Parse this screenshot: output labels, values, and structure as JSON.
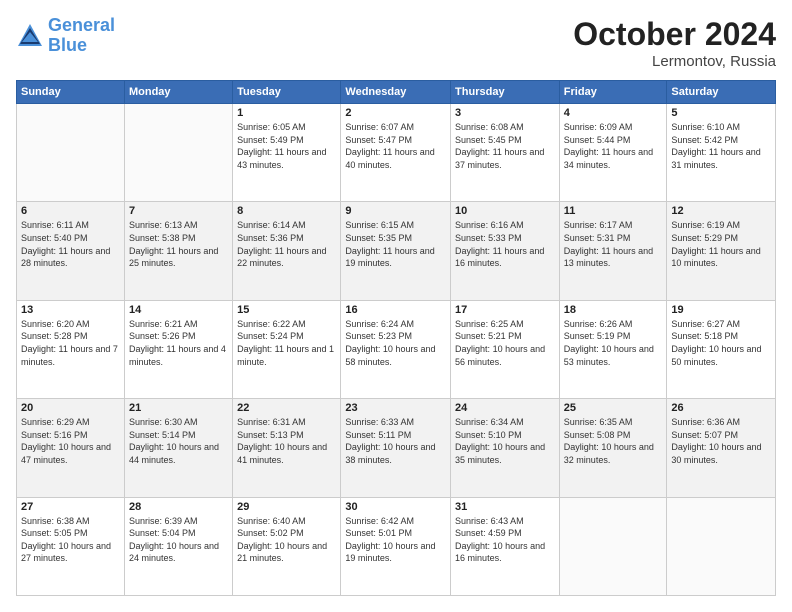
{
  "header": {
    "logo_line1": "General",
    "logo_line2": "Blue",
    "month": "October 2024",
    "location": "Lermontov, Russia"
  },
  "weekdays": [
    "Sunday",
    "Monday",
    "Tuesday",
    "Wednesday",
    "Thursday",
    "Friday",
    "Saturday"
  ],
  "weeks": [
    [
      {
        "day": "",
        "info": ""
      },
      {
        "day": "",
        "info": ""
      },
      {
        "day": "1",
        "info": "Sunrise: 6:05 AM\nSunset: 5:49 PM\nDaylight: 11 hours and 43 minutes."
      },
      {
        "day": "2",
        "info": "Sunrise: 6:07 AM\nSunset: 5:47 PM\nDaylight: 11 hours and 40 minutes."
      },
      {
        "day": "3",
        "info": "Sunrise: 6:08 AM\nSunset: 5:45 PM\nDaylight: 11 hours and 37 minutes."
      },
      {
        "day": "4",
        "info": "Sunrise: 6:09 AM\nSunset: 5:44 PM\nDaylight: 11 hours and 34 minutes."
      },
      {
        "day": "5",
        "info": "Sunrise: 6:10 AM\nSunset: 5:42 PM\nDaylight: 11 hours and 31 minutes."
      }
    ],
    [
      {
        "day": "6",
        "info": "Sunrise: 6:11 AM\nSunset: 5:40 PM\nDaylight: 11 hours and 28 minutes."
      },
      {
        "day": "7",
        "info": "Sunrise: 6:13 AM\nSunset: 5:38 PM\nDaylight: 11 hours and 25 minutes."
      },
      {
        "day": "8",
        "info": "Sunrise: 6:14 AM\nSunset: 5:36 PM\nDaylight: 11 hours and 22 minutes."
      },
      {
        "day": "9",
        "info": "Sunrise: 6:15 AM\nSunset: 5:35 PM\nDaylight: 11 hours and 19 minutes."
      },
      {
        "day": "10",
        "info": "Sunrise: 6:16 AM\nSunset: 5:33 PM\nDaylight: 11 hours and 16 minutes."
      },
      {
        "day": "11",
        "info": "Sunrise: 6:17 AM\nSunset: 5:31 PM\nDaylight: 11 hours and 13 minutes."
      },
      {
        "day": "12",
        "info": "Sunrise: 6:19 AM\nSunset: 5:29 PM\nDaylight: 11 hours and 10 minutes."
      }
    ],
    [
      {
        "day": "13",
        "info": "Sunrise: 6:20 AM\nSunset: 5:28 PM\nDaylight: 11 hours and 7 minutes."
      },
      {
        "day": "14",
        "info": "Sunrise: 6:21 AM\nSunset: 5:26 PM\nDaylight: 11 hours and 4 minutes."
      },
      {
        "day": "15",
        "info": "Sunrise: 6:22 AM\nSunset: 5:24 PM\nDaylight: 11 hours and 1 minute."
      },
      {
        "day": "16",
        "info": "Sunrise: 6:24 AM\nSunset: 5:23 PM\nDaylight: 10 hours and 58 minutes."
      },
      {
        "day": "17",
        "info": "Sunrise: 6:25 AM\nSunset: 5:21 PM\nDaylight: 10 hours and 56 minutes."
      },
      {
        "day": "18",
        "info": "Sunrise: 6:26 AM\nSunset: 5:19 PM\nDaylight: 10 hours and 53 minutes."
      },
      {
        "day": "19",
        "info": "Sunrise: 6:27 AM\nSunset: 5:18 PM\nDaylight: 10 hours and 50 minutes."
      }
    ],
    [
      {
        "day": "20",
        "info": "Sunrise: 6:29 AM\nSunset: 5:16 PM\nDaylight: 10 hours and 47 minutes."
      },
      {
        "day": "21",
        "info": "Sunrise: 6:30 AM\nSunset: 5:14 PM\nDaylight: 10 hours and 44 minutes."
      },
      {
        "day": "22",
        "info": "Sunrise: 6:31 AM\nSunset: 5:13 PM\nDaylight: 10 hours and 41 minutes."
      },
      {
        "day": "23",
        "info": "Sunrise: 6:33 AM\nSunset: 5:11 PM\nDaylight: 10 hours and 38 minutes."
      },
      {
        "day": "24",
        "info": "Sunrise: 6:34 AM\nSunset: 5:10 PM\nDaylight: 10 hours and 35 minutes."
      },
      {
        "day": "25",
        "info": "Sunrise: 6:35 AM\nSunset: 5:08 PM\nDaylight: 10 hours and 32 minutes."
      },
      {
        "day": "26",
        "info": "Sunrise: 6:36 AM\nSunset: 5:07 PM\nDaylight: 10 hours and 30 minutes."
      }
    ],
    [
      {
        "day": "27",
        "info": "Sunrise: 6:38 AM\nSunset: 5:05 PM\nDaylight: 10 hours and 27 minutes."
      },
      {
        "day": "28",
        "info": "Sunrise: 6:39 AM\nSunset: 5:04 PM\nDaylight: 10 hours and 24 minutes."
      },
      {
        "day": "29",
        "info": "Sunrise: 6:40 AM\nSunset: 5:02 PM\nDaylight: 10 hours and 21 minutes."
      },
      {
        "day": "30",
        "info": "Sunrise: 6:42 AM\nSunset: 5:01 PM\nDaylight: 10 hours and 19 minutes."
      },
      {
        "day": "31",
        "info": "Sunrise: 6:43 AM\nSunset: 4:59 PM\nDaylight: 10 hours and 16 minutes."
      },
      {
        "day": "",
        "info": ""
      },
      {
        "day": "",
        "info": ""
      }
    ]
  ]
}
